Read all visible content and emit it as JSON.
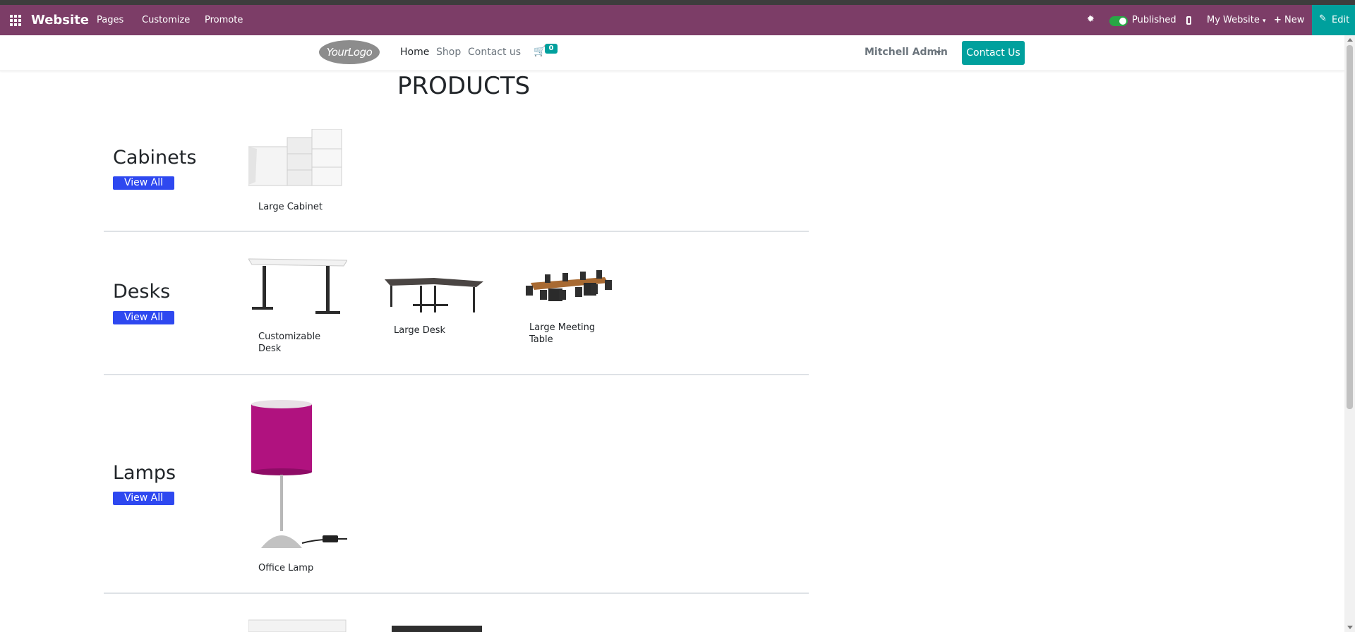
{
  "admin_bar": {
    "brand": "Website",
    "menu": [
      "Pages",
      "Customize",
      "Promote"
    ],
    "published_label": "Published",
    "my_website": "My Website",
    "new_label": "New",
    "edit_label": "Edit",
    "bg_color": "#7c3d67",
    "accent_color": "#00a09d"
  },
  "header": {
    "logo_text": "YourLogo",
    "nav": [
      "Home",
      "Shop",
      "Contact us"
    ],
    "cart_count": "0",
    "user_name": "Mitchell Admin",
    "contact_button": "Contact Us"
  },
  "page": {
    "title": "PRODUCTS",
    "view_all_label": "View All",
    "categories": [
      {
        "name": "Cabinets",
        "products": [
          "Large Cabinet"
        ]
      },
      {
        "name": "Desks",
        "products": [
          "Customizable Desk",
          "Large Desk",
          "Large Meeting Table"
        ]
      },
      {
        "name": "Lamps",
        "products": [
          "Office Lamp"
        ]
      }
    ]
  }
}
